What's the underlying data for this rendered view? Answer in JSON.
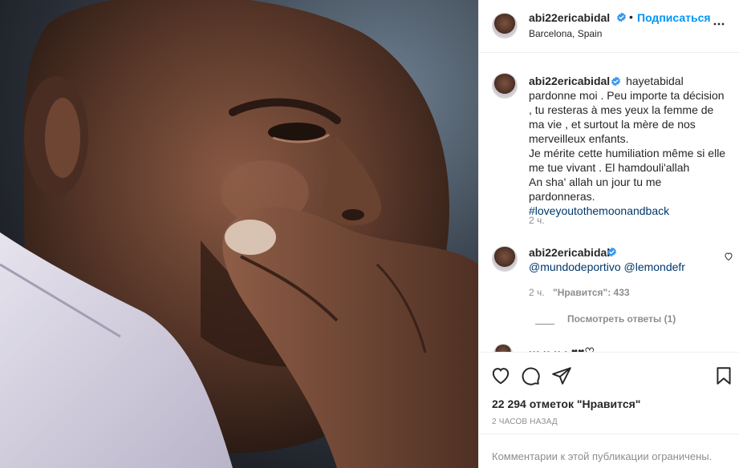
{
  "header": {
    "username": "abi22ericabidal",
    "follow_label": "Подписаться",
    "separator": "•",
    "location": "Barcelona, Spain",
    "more_icon": "more-horizontal-icon"
  },
  "photo": {
    "description_icon": "post-photo"
  },
  "caption": {
    "username": "abi22ericabidal",
    "text": "hayetabidal pardonne moi . Peu importe ta décision , tu resteras à mes yeux la femme de ma vie , et surtout la mère de nos merveilleux enfants.\nJe mérite cette humiliation même si elle me tue vivant . El hamdouli'allah\nAn sha' allah un jour tu me pardonneras.\n",
    "hashtag": "#loveyoutothemoonandback",
    "time": "2 ч."
  },
  "comment": {
    "username": "abi22ericabidal",
    "mentions": "@mundodeportivo @lemondefr",
    "time": "2 ч.",
    "likes": "\"Нравится\": 433",
    "view_replies": "Посмотреть ответы (1)"
  },
  "peek": {
    "text": "··· ·· ·· · ♥♥♡"
  },
  "actions": {
    "like_icon": "heart-icon",
    "comment_icon": "comment-icon",
    "share_icon": "share-icon",
    "save_icon": "bookmark-icon",
    "likes_count": "22 294 отметок \"Нравится\"",
    "posted": "2 ЧАСОВ НАЗАД"
  },
  "footer": {
    "comments_limited": "Комментарии к этой публикации ограничены."
  },
  "colors": {
    "link_blue": "#0095f6",
    "hashtag": "#00376b",
    "muted": "#8e8e8e",
    "border": "#efefef"
  }
}
